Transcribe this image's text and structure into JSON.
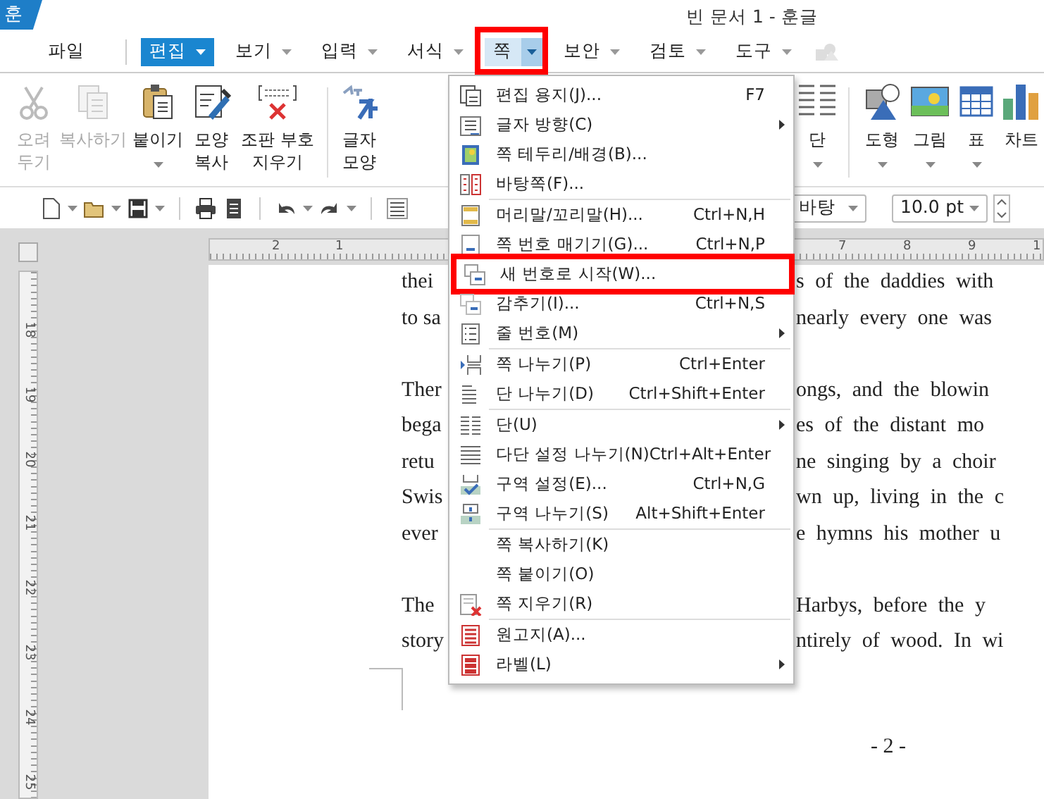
{
  "window": {
    "logo": "훈",
    "title": "빈 문서 1 - 훈글"
  },
  "menu_bar": [
    {
      "label": "파일",
      "caret": false,
      "selected": false,
      "open": false,
      "annotated": false
    },
    {
      "label": "편집",
      "caret": true,
      "selected": true,
      "open": false,
      "annotated": false
    },
    {
      "label": "보기",
      "caret": true,
      "selected": false,
      "open": false,
      "annotated": false
    },
    {
      "label": "입력",
      "caret": true,
      "selected": false,
      "open": false,
      "annotated": false
    },
    {
      "label": "서식",
      "caret": true,
      "selected": false,
      "open": false,
      "annotated": false
    },
    {
      "label": "쪽",
      "caret": true,
      "selected": false,
      "open": true,
      "annotated": true
    },
    {
      "label": "보안",
      "caret": true,
      "selected": false,
      "open": false,
      "annotated": false
    },
    {
      "label": "검토",
      "caret": true,
      "selected": false,
      "open": false,
      "annotated": false
    },
    {
      "label": "도구",
      "caret": true,
      "selected": false,
      "open": false,
      "annotated": false
    }
  ],
  "ribbon": {
    "left": [
      {
        "label": "오려\n두기",
        "disabled": true,
        "caret": false
      },
      {
        "label": "복사하기",
        "disabled": true,
        "caret": false
      },
      {
        "label": "붙이기",
        "disabled": false,
        "caret": true
      },
      {
        "label": "모양\n복사",
        "disabled": false,
        "caret": false
      },
      {
        "label": "조판 부호\n지우기",
        "disabled": false,
        "caret": false
      },
      {
        "label": "글자\n모양",
        "disabled": false,
        "caret": false
      }
    ],
    "right": [
      {
        "label": "단",
        "disabled": false,
        "caret": true
      },
      {
        "label": "도형",
        "disabled": false,
        "caret": true
      },
      {
        "label": "그림",
        "disabled": false,
        "caret": true
      },
      {
        "label": "표",
        "disabled": false,
        "caret": true
      },
      {
        "label": "차트",
        "disabled": false,
        "caret": false
      }
    ]
  },
  "toolbar": {
    "font": "바탕",
    "size": "10.0",
    "unit": "pt"
  },
  "ruler": {
    "left_numbers": [
      "2",
      "1"
    ],
    "right_numbers": [
      "7",
      "8",
      "9",
      "1"
    ],
    "vertical_numbers": [
      "18",
      "19",
      "20",
      "21",
      "22",
      "23",
      "24",
      "25"
    ]
  },
  "document": {
    "paragraphs": [
      {
        "lines": [
          {
            "left": "thei",
            "right": "s of the daddies with"
          },
          {
            "left": "to sa",
            "right": "nearly every one was"
          }
        ]
      },
      {
        "lines": [
          {
            "left": "Ther",
            "right": "ongs, and the blowin"
          },
          {
            "left": "bega",
            "right": "es of the distant mo"
          },
          {
            "left": "retu",
            "right": "ne singing by a choir"
          },
          {
            "left": "Swis",
            "right": "wn up, living in the c"
          },
          {
            "left": "ever",
            "right": "e hymns his mother u"
          }
        ]
      },
      {
        "lines": [
          {
            "left": "The",
            "right": "Harbys, before the y"
          },
          {
            "left": "story",
            "right": "ntirely of wood. In wi"
          }
        ]
      }
    ],
    "page_number": "- 2 -"
  },
  "dropdown": {
    "groups": [
      [
        {
          "label": "편집 용지(J)...",
          "shortcut": "F7",
          "submenu": false,
          "annotated": false
        },
        {
          "label": "글자 방향(C)",
          "submenu": true,
          "annotated": false
        },
        {
          "label": "쪽 테두리/배경(B)...",
          "submenu": false,
          "annotated": false
        },
        {
          "label": "바탕쪽(F)...",
          "submenu": false,
          "annotated": false
        }
      ],
      [
        {
          "label": "머리말/꼬리말(H)...",
          "shortcut": "Ctrl+N,H",
          "submenu": false,
          "annotated": false
        },
        {
          "label": "쪽 번호 매기기(G)...",
          "shortcut": "Ctrl+N,P",
          "submenu": false,
          "annotated": false
        },
        {
          "label": "새 번호로 시작(W)...",
          "submenu": false,
          "annotated": true
        },
        {
          "label": "감추기(I)...",
          "shortcut": "Ctrl+N,S",
          "submenu": false,
          "annotated": false
        },
        {
          "label": "줄 번호(M)",
          "submenu": true,
          "annotated": false
        }
      ],
      [
        {
          "label": "쪽 나누기(P)",
          "shortcut": "Ctrl+Enter",
          "submenu": false,
          "annotated": false
        },
        {
          "label": "단 나누기(D)",
          "shortcut": "Ctrl+Shift+Enter",
          "submenu": false,
          "annotated": false
        }
      ],
      [
        {
          "label": "단(U)",
          "submenu": true,
          "annotated": false
        },
        {
          "label": "다단 설정 나누기(N)",
          "shortcut": "Ctrl+Alt+Enter",
          "submenu": false,
          "annotated": false
        },
        {
          "label": "구역 설정(E)...",
          "shortcut": "Ctrl+N,G",
          "submenu": false,
          "annotated": false
        },
        {
          "label": "구역 나누기(S)",
          "shortcut": "Alt+Shift+Enter",
          "submenu": false,
          "annotated": false
        }
      ],
      [
        {
          "label": "쪽 복사하기(K)",
          "submenu": false,
          "annotated": false
        },
        {
          "label": "쪽 붙이기(O)",
          "submenu": false,
          "annotated": false
        },
        {
          "label": "쪽 지우기(R)",
          "submenu": false,
          "annotated": false
        }
      ],
      [
        {
          "label": "원고지(A)...",
          "submenu": false,
          "annotated": false
        },
        {
          "label": "라벨(L)",
          "submenu": true,
          "annotated": false
        }
      ]
    ]
  }
}
